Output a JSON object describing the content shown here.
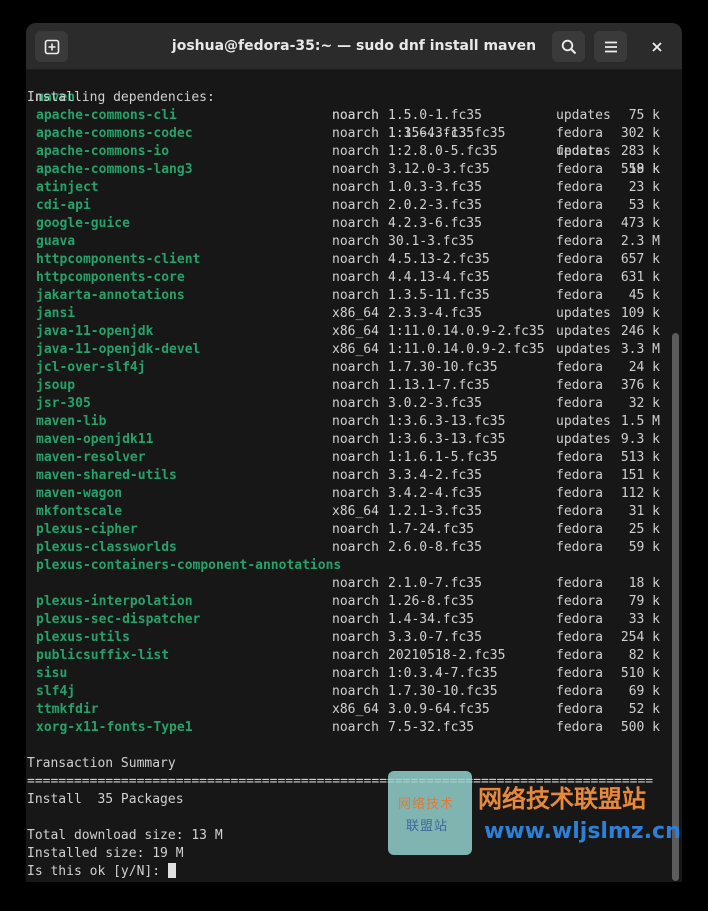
{
  "window": {
    "title": "joshua@fedora-35:~ — sudo dnf install maven"
  },
  "icons": {
    "new_tab": "new-tab-icon",
    "search": "search-icon",
    "menu": "hamburger-menu-icon",
    "close": "close-icon"
  },
  "colors": {
    "package_name": "#26a269",
    "background": "#171717",
    "headerbar": "#2b2b2b"
  },
  "terminal": {
    "first_pkg": {
      "name": "maven",
      "arch": "noarch",
      "version": "1:3.6.3-13.fc35",
      "repo": "updates",
      "size": "18 k"
    },
    "deps_header": "Installing dependencies:",
    "packages": [
      {
        "name": "apache-commons-cli",
        "arch": "noarch",
        "version": "1.5.0-1.fc35",
        "repo": "updates",
        "size": "75 k"
      },
      {
        "name": "apache-commons-codec",
        "arch": "noarch",
        "version": "1.15-4.fc35",
        "repo": "fedora",
        "size": "302 k"
      },
      {
        "name": "apache-commons-io",
        "arch": "noarch",
        "version": "1:2.8.0-5.fc35",
        "repo": "fedora",
        "size": "283 k"
      },
      {
        "name": "apache-commons-lang3",
        "arch": "noarch",
        "version": "3.12.0-3.fc35",
        "repo": "fedora",
        "size": "559 k"
      },
      {
        "name": "atinject",
        "arch": "noarch",
        "version": "1.0.3-3.fc35",
        "repo": "fedora",
        "size": "23 k"
      },
      {
        "name": "cdi-api",
        "arch": "noarch",
        "version": "2.0.2-3.fc35",
        "repo": "fedora",
        "size": "53 k"
      },
      {
        "name": "google-guice",
        "arch": "noarch",
        "version": "4.2.3-6.fc35",
        "repo": "fedora",
        "size": "473 k"
      },
      {
        "name": "guava",
        "arch": "noarch",
        "version": "30.1-3.fc35",
        "repo": "fedora",
        "size": "2.3 M"
      },
      {
        "name": "httpcomponents-client",
        "arch": "noarch",
        "version": "4.5.13-2.fc35",
        "repo": "fedora",
        "size": "657 k"
      },
      {
        "name": "httpcomponents-core",
        "arch": "noarch",
        "version": "4.4.13-4.fc35",
        "repo": "fedora",
        "size": "631 k"
      },
      {
        "name": "jakarta-annotations",
        "arch": "noarch",
        "version": "1.3.5-11.fc35",
        "repo": "fedora",
        "size": "45 k"
      },
      {
        "name": "jansi",
        "arch": "x86_64",
        "version": "2.3.3-4.fc35",
        "repo": "updates",
        "size": "109 k"
      },
      {
        "name": "java-11-openjdk",
        "arch": "x86_64",
        "version": "1:11.0.14.0.9-2.fc35",
        "repo": "updates",
        "size": "246 k"
      },
      {
        "name": "java-11-openjdk-devel",
        "arch": "x86_64",
        "version": "1:11.0.14.0.9-2.fc35",
        "repo": "updates",
        "size": "3.3 M"
      },
      {
        "name": "jcl-over-slf4j",
        "arch": "noarch",
        "version": "1.7.30-10.fc35",
        "repo": "fedora",
        "size": "24 k"
      },
      {
        "name": "jsoup",
        "arch": "noarch",
        "version": "1.13.1-7.fc35",
        "repo": "fedora",
        "size": "376 k"
      },
      {
        "name": "jsr-305",
        "arch": "noarch",
        "version": "3.0.2-3.fc35",
        "repo": "fedora",
        "size": "32 k"
      },
      {
        "name": "maven-lib",
        "arch": "noarch",
        "version": "1:3.6.3-13.fc35",
        "repo": "updates",
        "size": "1.5 M"
      },
      {
        "name": "maven-openjdk11",
        "arch": "noarch",
        "version": "1:3.6.3-13.fc35",
        "repo": "updates",
        "size": "9.3 k"
      },
      {
        "name": "maven-resolver",
        "arch": "noarch",
        "version": "1:1.6.1-5.fc35",
        "repo": "fedora",
        "size": "513 k"
      },
      {
        "name": "maven-shared-utils",
        "arch": "noarch",
        "version": "3.3.4-2.fc35",
        "repo": "fedora",
        "size": "151 k"
      },
      {
        "name": "maven-wagon",
        "arch": "noarch",
        "version": "3.4.2-4.fc35",
        "repo": "fedora",
        "size": "112 k"
      },
      {
        "name": "mkfontscale",
        "arch": "x86_64",
        "version": "1.2.1-3.fc35",
        "repo": "fedora",
        "size": "31 k"
      },
      {
        "name": "plexus-cipher",
        "arch": "noarch",
        "version": "1.7-24.fc35",
        "repo": "fedora",
        "size": "25 k"
      },
      {
        "name": "plexus-classworlds",
        "arch": "noarch",
        "version": "2.6.0-8.fc35",
        "repo": "fedora",
        "size": "59 k"
      },
      {
        "name": "plexus-containers-component-annotations",
        "arch": "noarch",
        "version": "2.1.0-7.fc35",
        "repo": "fedora",
        "size": "18 k",
        "wrapped": true
      },
      {
        "name": "plexus-interpolation",
        "arch": "noarch",
        "version": "1.26-8.fc35",
        "repo": "fedora",
        "size": "79 k"
      },
      {
        "name": "plexus-sec-dispatcher",
        "arch": "noarch",
        "version": "1.4-34.fc35",
        "repo": "fedora",
        "size": "33 k"
      },
      {
        "name": "plexus-utils",
        "arch": "noarch",
        "version": "3.3.0-7.fc35",
        "repo": "fedora",
        "size": "254 k"
      },
      {
        "name": "publicsuffix-list",
        "arch": "noarch",
        "version": "20210518-2.fc35",
        "repo": "fedora",
        "size": "82 k"
      },
      {
        "name": "sisu",
        "arch": "noarch",
        "version": "1:0.3.4-7.fc35",
        "repo": "fedora",
        "size": "510 k"
      },
      {
        "name": "slf4j",
        "arch": "noarch",
        "version": "1.7.30-10.fc35",
        "repo": "fedora",
        "size": "69 k"
      },
      {
        "name": "ttmkfdir",
        "arch": "x86_64",
        "version": "3.0.9-64.fc35",
        "repo": "fedora",
        "size": "52 k"
      },
      {
        "name": "xorg-x11-fonts-Type1",
        "arch": "noarch",
        "version": "7.5-32.fc35",
        "repo": "fedora",
        "size": "500 k"
      }
    ],
    "summary_title": "Transaction Summary",
    "separator": "================================================================================",
    "install_line": "Install  35 Packages",
    "download_size": "Total download size: 13 M",
    "installed_size": "Installed size: 19 M",
    "prompt": "Is this ok [y/N]: "
  },
  "watermark": {
    "box_line1": "网络技术",
    "box_line2": "联盟站",
    "cn_text": "网络技术联盟站",
    "url": "www.wljslmz.cn"
  }
}
